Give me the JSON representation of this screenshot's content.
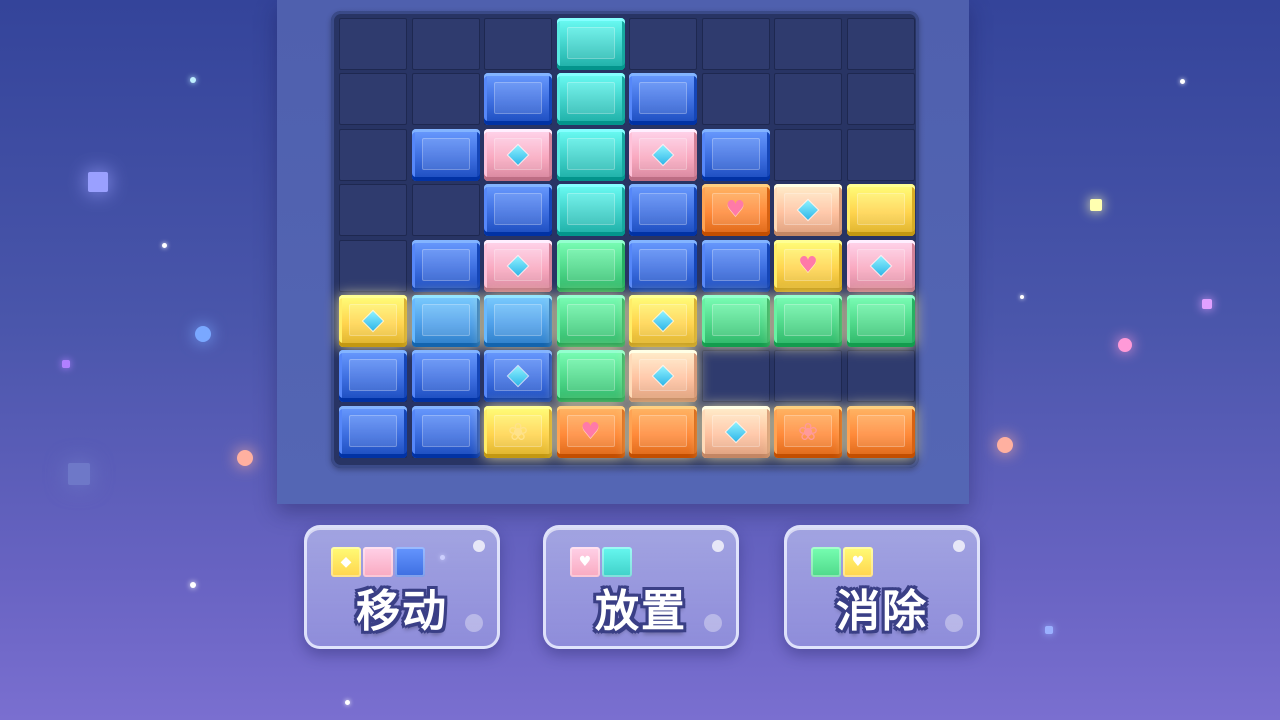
{
  "game": {
    "board": {
      "cols": 8,
      "rows": 8
    },
    "colors": {
      "blue": "#3d6ee0",
      "lightblue": "#4fa0ea",
      "teal": "#3fd0c8",
      "green": "#4fd88a",
      "yellow": "#ffd44e",
      "orange": "#ff8a3a",
      "pink": "#f9a9c0",
      "peach": "#ffc2a0"
    },
    "blocks": [
      {
        "row": 0,
        "col": 3,
        "color": "teal"
      },
      {
        "row": 1,
        "col": 2,
        "color": "blue"
      },
      {
        "row": 1,
        "col": 3,
        "color": "teal"
      },
      {
        "row": 1,
        "col": 4,
        "color": "blue"
      },
      {
        "row": 2,
        "col": 1,
        "color": "blue"
      },
      {
        "row": 2,
        "col": 2,
        "color": "pink",
        "gem": "diamond"
      },
      {
        "row": 2,
        "col": 3,
        "color": "teal"
      },
      {
        "row": 2,
        "col": 4,
        "color": "pink",
        "gem": "diamond"
      },
      {
        "row": 2,
        "col": 5,
        "color": "blue"
      },
      {
        "row": 3,
        "col": 2,
        "color": "blue"
      },
      {
        "row": 3,
        "col": 3,
        "color": "teal"
      },
      {
        "row": 3,
        "col": 4,
        "color": "blue"
      },
      {
        "row": 3,
        "col": 5,
        "color": "orange",
        "gem": "heart"
      },
      {
        "row": 3,
        "col": 6,
        "color": "peach",
        "gem": "diamond"
      },
      {
        "row": 3,
        "col": 7,
        "color": "yellow"
      },
      {
        "row": 4,
        "col": 1,
        "color": "blue"
      },
      {
        "row": 4,
        "col": 2,
        "color": "pink",
        "gem": "diamond"
      },
      {
        "row": 4,
        "col": 3,
        "color": "green"
      },
      {
        "row": 4,
        "col": 4,
        "color": "blue"
      },
      {
        "row": 4,
        "col": 5,
        "color": "blue"
      },
      {
        "row": 4,
        "col": 6,
        "color": "yellow",
        "gem": "heart"
      },
      {
        "row": 4,
        "col": 7,
        "color": "pink",
        "gem": "diamond"
      },
      {
        "row": 5,
        "col": 0,
        "color": "yellow",
        "gem": "diamond",
        "glow": true
      },
      {
        "row": 5,
        "col": 1,
        "color": "lightblue",
        "glow": true
      },
      {
        "row": 5,
        "col": 2,
        "color": "lightblue",
        "glow": true
      },
      {
        "row": 5,
        "col": 3,
        "color": "green",
        "glow": true
      },
      {
        "row": 5,
        "col": 4,
        "color": "yellow",
        "gem": "diamond",
        "glow": true
      },
      {
        "row": 5,
        "col": 5,
        "color": "green",
        "glow": true
      },
      {
        "row": 5,
        "col": 6,
        "color": "green",
        "glow": true
      },
      {
        "row": 5,
        "col": 7,
        "color": "green",
        "glow": true
      },
      {
        "row": 6,
        "col": 0,
        "color": "blue"
      },
      {
        "row": 6,
        "col": 1,
        "color": "blue"
      },
      {
        "row": 6,
        "col": 2,
        "color": "blue",
        "gem": "diamond"
      },
      {
        "row": 6,
        "col": 3,
        "color": "green",
        "glow": true
      },
      {
        "row": 6,
        "col": 4,
        "color": "peach",
        "gem": "diamond",
        "glow": true
      },
      {
        "row": 7,
        "col": 0,
        "color": "blue"
      },
      {
        "row": 7,
        "col": 1,
        "color": "blue"
      },
      {
        "row": 7,
        "col": 2,
        "color": "yellow",
        "gem": "flower",
        "glow": true
      },
      {
        "row": 7,
        "col": 3,
        "color": "orange",
        "gem": "heart",
        "glow": true
      },
      {
        "row": 7,
        "col": 4,
        "color": "orange",
        "glow": true
      },
      {
        "row": 7,
        "col": 5,
        "color": "peach",
        "gem": "diamond",
        "glow": true
      },
      {
        "row": 7,
        "col": 6,
        "color": "orange",
        "gem": "flower-pink",
        "glow": true
      },
      {
        "row": 7,
        "col": 7,
        "color": "orange",
        "glow": true
      }
    ]
  },
  "buttons": [
    {
      "id": "move",
      "label": "移动",
      "minis": [
        {
          "color": "yellow",
          "gem": "diamond"
        },
        {
          "color": "pink"
        },
        {
          "color": "blue"
        }
      ]
    },
    {
      "id": "place",
      "label": "放置",
      "minis": [
        {
          "color": "pink",
          "gem": "heart"
        },
        {
          "color": "teal"
        }
      ]
    },
    {
      "id": "clear",
      "label": "消除",
      "minis": [
        {
          "color": "green"
        },
        {
          "color": "yellow",
          "gem": "heart"
        }
      ]
    }
  ]
}
